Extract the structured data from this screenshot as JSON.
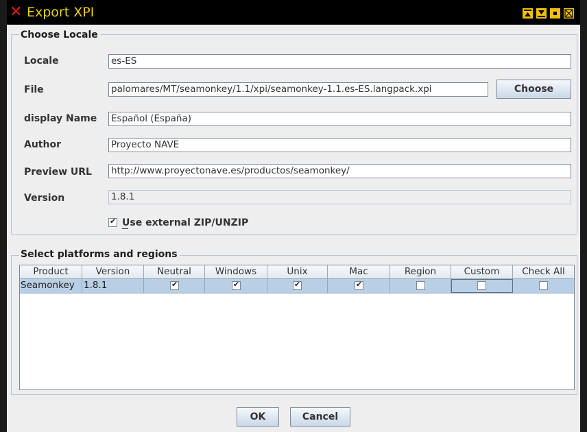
{
  "window": {
    "title": "Export XPI",
    "title_controls": [
      "minimize-icon",
      "maximize-icon",
      "restore-icon",
      "close-icon"
    ]
  },
  "locale_group": {
    "legend": "Choose Locale",
    "locale_label": "Locale",
    "locale_value": "es-ES",
    "file_label": "File",
    "file_value": "palomares/MT/seamonkey/1.1/xpi/seamonkey-1.1.es-ES.langpack.xpi",
    "choose_button": "Choose",
    "display_name_label": "display Name",
    "display_name_value": "Español (España)",
    "author_label": "Author",
    "author_value": "Proyecto NAVE",
    "preview_url_label": "Preview URL",
    "preview_url_value": "http://www.proyectonave.es/productos/seamonkey/",
    "version_label": "Version",
    "version_value": "1.8.1",
    "use_external_zip_label": "Use external ZIP/UNZIP",
    "use_external_zip_checked": true
  },
  "platforms_group": {
    "legend": "Select platforms and regions",
    "columns": [
      "Product",
      "Version",
      "Neutral",
      "Windows",
      "Unix",
      "Mac",
      "Region",
      "Custom",
      "Check All"
    ],
    "rows": [
      {
        "product": "Seamonkey",
        "version": "1.8.1",
        "neutral": true,
        "windows": true,
        "unix": true,
        "mac": true,
        "region": false,
        "custom": false,
        "check_all": false
      }
    ]
  },
  "buttons": {
    "ok": "OK",
    "cancel": "Cancel"
  },
  "colors": {
    "title_bar": "#000000",
    "title_text": "#f0d000",
    "close_x": "#e01818",
    "selected_row": "#b8cfe5"
  }
}
